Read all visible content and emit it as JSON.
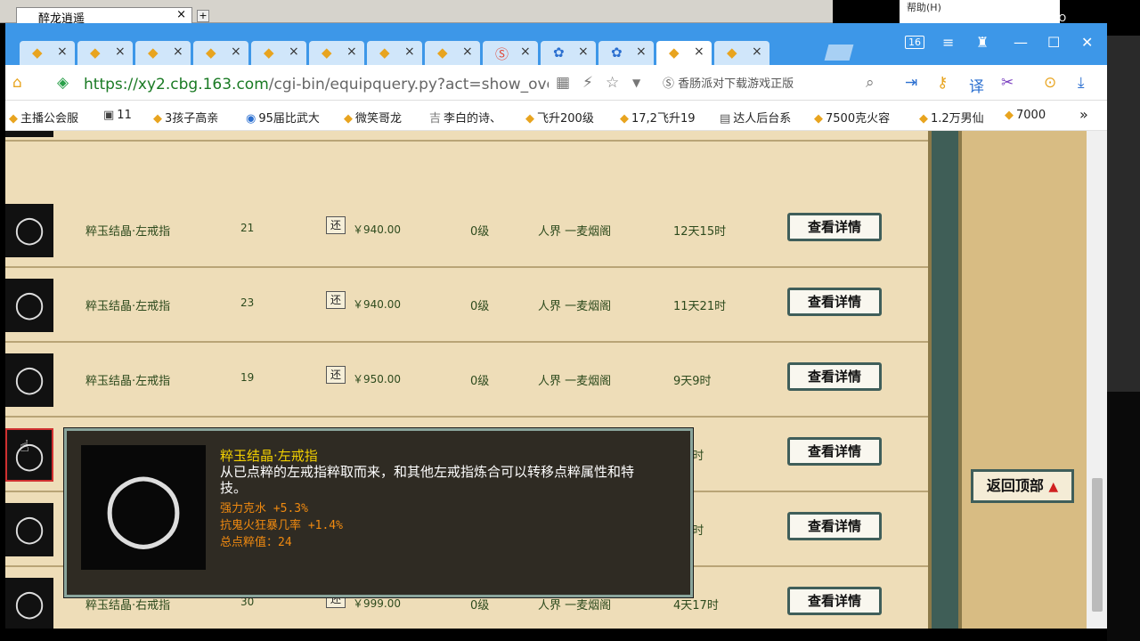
{
  "bg_window": {
    "tab_title": "醉龙逍遥",
    "tab_close": "×",
    "new_tab": "+",
    "help": "帮助(H)",
    "right_text": "GO"
  },
  "browser": {
    "tabs": [
      {
        "icon": "chick-icon",
        "close": "×"
      },
      {
        "icon": "chick-icon",
        "close": "×"
      },
      {
        "icon": "chick-icon",
        "close": "×"
      },
      {
        "icon": "chick-icon",
        "close": "×"
      },
      {
        "icon": "chick-icon",
        "close": "×"
      },
      {
        "icon": "chick-icon",
        "close": "×"
      },
      {
        "icon": "chick-icon",
        "close": "×"
      },
      {
        "icon": "chick-icon",
        "close": "×"
      },
      {
        "icon": "s-icon",
        "close": "×"
      },
      {
        "icon": "butterfly-icon",
        "close": "×"
      },
      {
        "icon": "butterfly-icon",
        "close": "×"
      },
      {
        "icon": "chick-icon",
        "close": "×"
      },
      {
        "icon": "chick-icon",
        "close": "×"
      }
    ],
    "window_badge": "16",
    "address": {
      "url_host": "https://xy2.cbg.163.com",
      "url_path": "/cgi-bin/equipquery.py?act=show_overall_se",
      "search_text": "香肠派对下载游戏正版"
    },
    "bookmarks": [
      "主播公会服",
      "11",
      "3孩子高亲",
      "95届比武大",
      "微笑哥龙",
      "李白的诗、",
      "飞升200级",
      "17,2飞升19",
      "达人后台系",
      "7500克火容",
      "1.2万男仙",
      "7000"
    ],
    "bookmarks_more": "»"
  },
  "listing": {
    "rows": [
      {
        "name": "粹玉结晶·左戒指",
        "level": "21",
        "pay_badge": "还",
        "price": "￥940.00",
        "grade": "0级",
        "server": "人界  一麦烟阁",
        "time_left": "12天15时",
        "button": "查看详情"
      },
      {
        "name": "粹玉结晶·左戒指",
        "level": "23",
        "pay_badge": "还",
        "price": "￥940.00",
        "grade": "0级",
        "server": "人界  一麦烟阁",
        "time_left": "11天21时",
        "button": "查看详情"
      },
      {
        "name": "粹玉结晶·左戒指",
        "level": "19",
        "pay_badge": "还",
        "price": "￥950.00",
        "grade": "0级",
        "server": "人界  一麦烟阁",
        "time_left": "9天9时",
        "button": "查看详情"
      },
      {
        "name": "",
        "level": "",
        "pay_badge": "",
        "price": "",
        "grade": "",
        "server": "",
        "time_left": "天5时",
        "button": "查看详情"
      },
      {
        "name": "",
        "level": "",
        "pay_badge": "",
        "price": "",
        "grade": "",
        "server": "",
        "time_left": "天4时",
        "button": "查看详情"
      },
      {
        "name": "粹玉结晶·右戒指",
        "level": "30",
        "pay_badge": "还",
        "price": "￥999.00",
        "grade": "0级",
        "server": "人界  一麦烟阁",
        "time_left": "4天17时",
        "button": "查看详情"
      }
    ],
    "back_to_top": "返回顶部",
    "back_to_top_arrow": "▲"
  },
  "tooltip": {
    "title": "粹玉结晶·左戒指",
    "description": "从已点粹的左戒指粹取而来，和其他左戒指炼合可以转移点粹属性和特技。",
    "attrs": [
      "强力克水 +5.3%",
      "抗鬼火狂暴几率 +1.4%",
      "总点粹值：24"
    ]
  },
  "colors": {
    "tab_bar": "#3d97e8",
    "content_bg": "#eeddb8",
    "tooltip_bg": "#2f2b23",
    "tooltip_title": "#f2d000",
    "tooltip_attr": "#f08a10"
  }
}
